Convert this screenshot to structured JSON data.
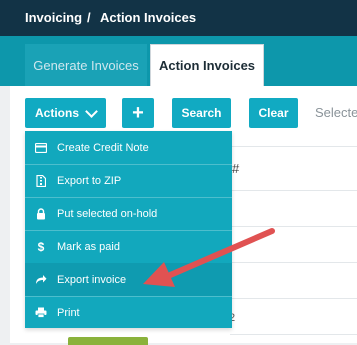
{
  "breadcrumb": {
    "root": "Invoicing",
    "separator": "/",
    "current": "Action Invoices"
  },
  "tabs": [
    {
      "label": "Generate Invoices"
    },
    {
      "label": "Action Invoices"
    }
  ],
  "toolbar": {
    "actions_label": "Actions",
    "add_label": "+",
    "search_label": "Search",
    "clear_label": "Clear",
    "selected_text": "Selecte"
  },
  "dropdown": {
    "items": [
      {
        "label": "Create Credit Note",
        "icon": "credit-card-icon"
      },
      {
        "label": "Export to ZIP",
        "icon": "file-zip-icon"
      },
      {
        "label": "Put selected on-hold",
        "icon": "lock-icon"
      },
      {
        "label": "Mark as paid",
        "icon": "dollar-icon"
      },
      {
        "label": "Export invoice",
        "icon": "share-icon"
      },
      {
        "label": "Print",
        "icon": "print-icon"
      }
    ]
  },
  "table": {
    "hash_header": "#",
    "partial_cell": "2"
  },
  "colors": {
    "topbar": "#123346",
    "accent": "#11aac2",
    "arrow": "#e05252",
    "status_green": "#8ab23b"
  }
}
